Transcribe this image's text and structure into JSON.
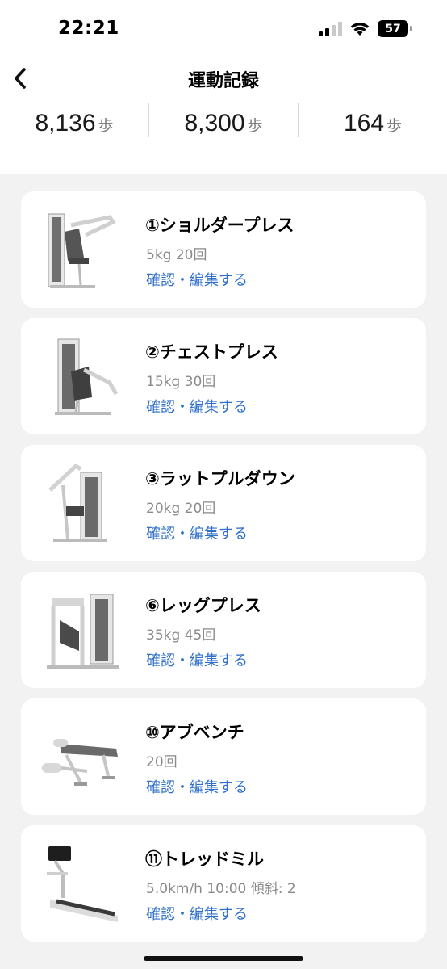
{
  "status_bar": {
    "time": "22:21",
    "battery": "57",
    "icons": [
      "signal-icon",
      "wifi-icon",
      "battery-icon"
    ]
  },
  "header": {
    "title": "運動記録",
    "back_icon": "chevron-left-icon"
  },
  "stats": [
    {
      "value": "8,136",
      "unit": "歩"
    },
    {
      "value": "8,300",
      "unit": "歩"
    },
    {
      "value": "164",
      "unit": "歩"
    }
  ],
  "exercises": [
    {
      "name": "①ショルダープレス",
      "detail": "5kg 20回",
      "link": "確認・編集する",
      "icon": "shoulder-press-machine-icon"
    },
    {
      "name": "②チェストプレス",
      "detail": "15kg 30回",
      "link": "確認・編集する",
      "icon": "chest-press-machine-icon"
    },
    {
      "name": "③ラットプルダウン",
      "detail": "20kg 20回",
      "link": "確認・編集する",
      "icon": "lat-pulldown-machine-icon"
    },
    {
      "name": "⑥レッグプレス",
      "detail": "35kg 45回",
      "link": "確認・編集する",
      "icon": "leg-press-machine-icon"
    },
    {
      "name": "⑩アブベンチ",
      "detail": "20回",
      "link": "確認・編集する",
      "icon": "ab-bench-icon"
    },
    {
      "name": "⑪トレッドミル",
      "detail": "5.0km/h 10:00 傾斜: 2",
      "link": "確認・編集する",
      "icon": "treadmill-icon"
    }
  ],
  "colors": {
    "link": "#2f6fc9",
    "background": "#f2f2f2",
    "card": "#ffffff"
  }
}
